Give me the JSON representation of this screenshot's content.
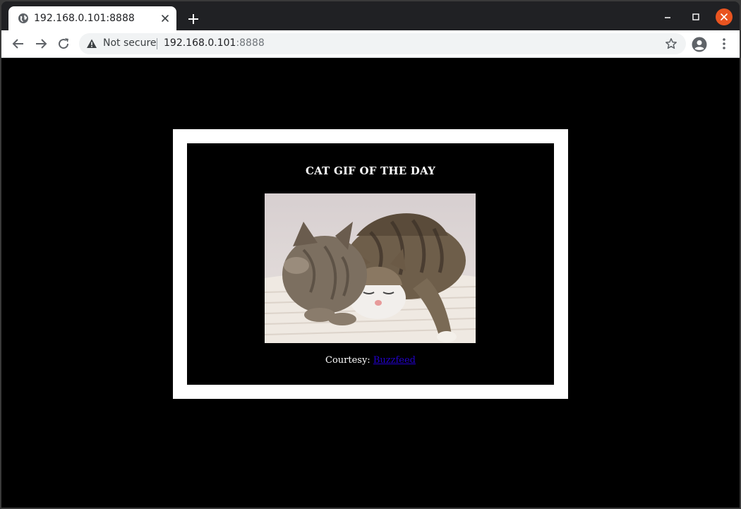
{
  "browser": {
    "tab_title": "192.168.0.101:8888",
    "security_label": "Not secure",
    "url_host": "192.168.0.101",
    "url_port": ":8888"
  },
  "page": {
    "heading": "CAT GIF OF THE DAY",
    "courtesy_label": "Courtesy:",
    "courtesy_link": "Buzzfeed",
    "image_alt": "two cats sleeping"
  },
  "colors": {
    "page_background": "#000000",
    "frame": "#ffffff",
    "link": "#2200cc",
    "close_button": "#e95420"
  }
}
